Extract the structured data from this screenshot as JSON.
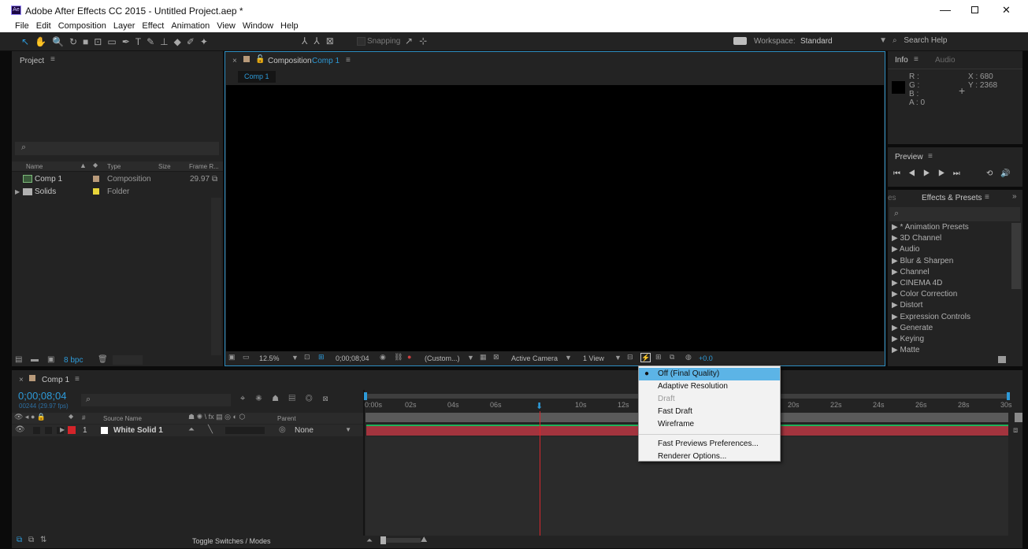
{
  "window": {
    "title": "Adobe After Effects CC 2015 - Untitled Project.aep *"
  },
  "menu": [
    "File",
    "Edit",
    "Composition",
    "Layer",
    "Effect",
    "Animation",
    "View",
    "Window",
    "Help"
  ],
  "toolbar": {
    "snapping": "Snapping",
    "workspace_label": "Workspace:",
    "workspace_value": "Standard",
    "search_help": "Search Help"
  },
  "project": {
    "title": "Project",
    "columns": {
      "name": "Name",
      "type": "Type",
      "size": "Size",
      "frame_rate": "Frame R..."
    },
    "items": [
      {
        "name": "Comp 1",
        "type": "Composition",
        "frame_rate": "29.97"
      },
      {
        "name": "Solids",
        "type": "Folder",
        "frame_rate": ""
      }
    ],
    "bpc": "8 bpc"
  },
  "composition": {
    "panel_label": "Composition",
    "comp_name": "Comp 1",
    "tab": "Comp 1",
    "zoom": "12.5%",
    "timecode": "0;00;08;04",
    "resolution": "(Custom...)",
    "camera": "Active Camera",
    "views": "1 View",
    "exposure": "+0.0"
  },
  "info": {
    "tab_info": "Info",
    "tab_audio": "Audio",
    "r": "R :",
    "g": "G :",
    "b": "B :",
    "a": "A : 0",
    "x": "X : 680",
    "y": "Y : 2368"
  },
  "preview": {
    "title": "Preview"
  },
  "effects": {
    "tab_es": "es",
    "title": "Effects & Presets",
    "items": [
      "* Animation Presets",
      "3D Channel",
      "Audio",
      "Blur & Sharpen",
      "Channel",
      "CINEMA 4D",
      "Color Correction",
      "Distort",
      "Expression Controls",
      "Generate",
      "Keying",
      "Matte"
    ]
  },
  "dropdown": {
    "items": [
      {
        "label": "Off (Final Quality)",
        "selected": true
      },
      {
        "label": "Adaptive Resolution"
      },
      {
        "label": "Draft",
        "disabled": true
      },
      {
        "label": "Fast Draft"
      },
      {
        "label": "Wireframe"
      }
    ],
    "items2": [
      "Fast Previews Preferences...",
      "Renderer Options..."
    ]
  },
  "timeline": {
    "tab": "Comp 1",
    "timecode": "0;00;08;04",
    "frames": "00244 (29.97 fps)",
    "col_source": "Source Name",
    "col_parent": "Parent",
    "layer": {
      "num": "1",
      "name": "White Solid 1",
      "parent": "None"
    },
    "toggle": "Toggle Switches / Modes",
    "ruler": [
      "0:00s",
      "02s",
      "04s",
      "06s",
      "08s",
      "10s",
      "12s",
      "",
      "",
      "",
      "20s",
      "22s",
      "24s",
      "26s",
      "28s",
      "30s"
    ]
  },
  "colors": {
    "accent": "#2d9ad8",
    "layer_bar": "#a3343e",
    "playhead": "#d8272d",
    "menu_highlight": "#5cb4e6"
  }
}
